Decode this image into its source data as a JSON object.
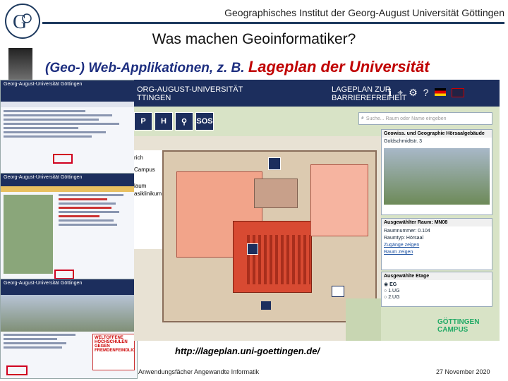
{
  "header": {
    "institute": "Geographisches Institut der Georg-August Universität Göttingen",
    "title": "Was machen Geoinformatiker?",
    "subtitle_prefix": "(Geo-) Web-Applikationen, z. B. ",
    "subtitle_emphasis": "Lageplan der Universität"
  },
  "map_app": {
    "header_left": "ORG-AUGUST-UNIVERSITÄT",
    "header_left2": "TTINGEN",
    "header_right": "LAGEPLAN ZUR",
    "header_right2": "BARRIEREFREIHEIT",
    "toolbar": [
      "P",
      "H",
      "SOS"
    ],
    "search_placeholder": "Suche... Raum oder Name eingeben",
    "building_panel": {
      "title": "Geowiss. und Geographie Hörsaalgebäude",
      "address": "Goldschmidtstr. 3"
    },
    "room_panel": {
      "title": "Ausgewählter Raum: MN08",
      "lines": [
        "Raumnummer: 0.104",
        "Raumtyp: Hörsaal",
        "Zugänge zeigen",
        "Raum zeigen"
      ]
    },
    "floor_panel": {
      "title": "Ausgewählte Etage",
      "options": [
        "EG",
        "1.UG",
        "2.UG"
      ]
    },
    "left_labels": [
      "rich",
      "Campus",
      "laum",
      "asiklinikum"
    ],
    "campus_logo": "GÖTTINGEN CAMPUS"
  },
  "stacked_screens": {
    "top": {
      "header": "Georg-August-Universität Göttingen"
    },
    "middle": {
      "header": "Georg-August-Universität Göttingen"
    },
    "bottom": {
      "header": "Georg-August-Universität Göttingen"
    },
    "badge": "WELTOFFENE HOCHSCHULEN GEGEN FREMDENFEINDLICHKEIT"
  },
  "url": "http://lageplan.uni-goettingen.de/",
  "footer": {
    "left": "Anwendungsfächer Angewandte Informatik",
    "right": "27 November 2020"
  }
}
